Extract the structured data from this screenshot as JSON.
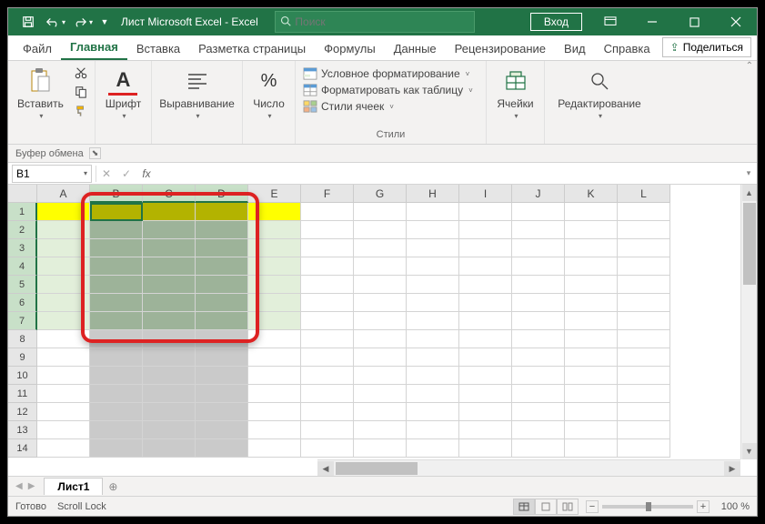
{
  "titlebar": {
    "title": "Лист Microsoft Excel  -  Excel",
    "search_placeholder": "Поиск",
    "login": "Вход"
  },
  "tabs": {
    "file": "Файл",
    "home": "Главная",
    "insert": "Вставка",
    "layout": "Разметка страницы",
    "formulas": "Формулы",
    "data": "Данные",
    "review": "Рецензирование",
    "view": "Вид",
    "help": "Справка",
    "share": "Поделиться"
  },
  "ribbon": {
    "paste": "Вставить",
    "clipboard_group": "Буфер обмена",
    "font": "Шрифт",
    "alignment": "Выравнивание",
    "number": "Число",
    "cond_format": "Условное форматирование",
    "format_table": "Форматировать как таблицу",
    "cell_styles": "Стили ячеек",
    "styles_group": "Стили",
    "cells": "Ячейки",
    "editing": "Редактирование"
  },
  "formula": {
    "namebox": "B1"
  },
  "columns": [
    "A",
    "B",
    "C",
    "D",
    "E",
    "F",
    "G",
    "H",
    "I",
    "J",
    "K",
    "L"
  ],
  "rows": [
    "1",
    "2",
    "3",
    "4",
    "5",
    "6",
    "7",
    "8",
    "9",
    "10",
    "11",
    "12",
    "13",
    "14"
  ],
  "sheet": {
    "tab1": "Лист1"
  },
  "status": {
    "ready": "Готово",
    "scroll_lock": "Scroll Lock",
    "zoom": "100 %"
  }
}
